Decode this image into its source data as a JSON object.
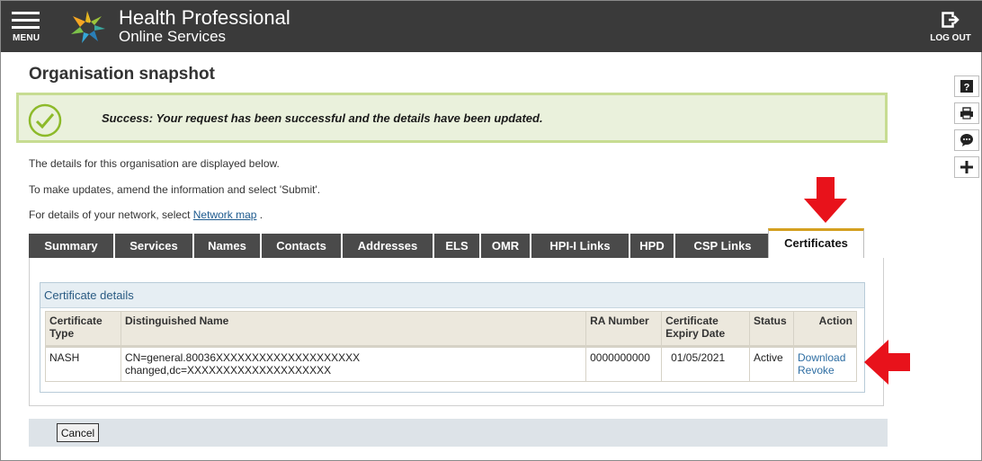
{
  "header": {
    "menu_label": "MENU",
    "brand_line1": "Health Professional",
    "brand_line2": "Online Services",
    "logout_label": "LOG OUT"
  },
  "side_tools": [
    "help-icon",
    "print-icon",
    "feedback-icon",
    "add-icon"
  ],
  "page": {
    "title": "Organisation snapshot",
    "success_message": "Success: Your request has been successful and the details have been updated.",
    "intro1": "The details for this organisation are displayed below.",
    "intro2": "To make updates, amend the information and select 'Submit'.",
    "intro3_prefix": "For details of your network, select",
    "intro3_link": "Network map",
    "intro3_suffix": "."
  },
  "tabs": [
    {
      "label": "Summary"
    },
    {
      "label": "Services"
    },
    {
      "label": "Names"
    },
    {
      "label": "Contacts"
    },
    {
      "label": "Addresses"
    },
    {
      "label": "ELS"
    },
    {
      "label": "OMR"
    },
    {
      "label": "HPI-I Links"
    },
    {
      "label": "HPD"
    },
    {
      "label": "CSP Links"
    },
    {
      "label": "Certificates",
      "active": true
    }
  ],
  "certificates": {
    "section_title": "Certificate details",
    "columns": {
      "type": "Certificate Type",
      "dn": "Distinguished Name",
      "ra": "RA Number",
      "expiry": "Certificate Expiry Date",
      "status": "Status",
      "action": "Action"
    },
    "row": {
      "type": "NASH",
      "dn_line1": "CN=general.80036XXXXXXXXXXXXXXXXXXXX",
      "dn_line2": "changed,dc=XXXXXXXXXXXXXXXXXXXX",
      "ra": "0000000000",
      "expiry": "01/05/2021",
      "status": "Active",
      "action1": "Download",
      "action2": "Revoke"
    }
  },
  "footer": {
    "cancel_label": "Cancel"
  },
  "colors": {
    "header_bg": "#3a3a3a",
    "success_bg": "#eaf1dc",
    "success_border": "#c7dc92",
    "tab_bg": "#4a4a4a",
    "tab_active_accent": "#d4a020",
    "annotation_arrow": "#e8121b"
  }
}
